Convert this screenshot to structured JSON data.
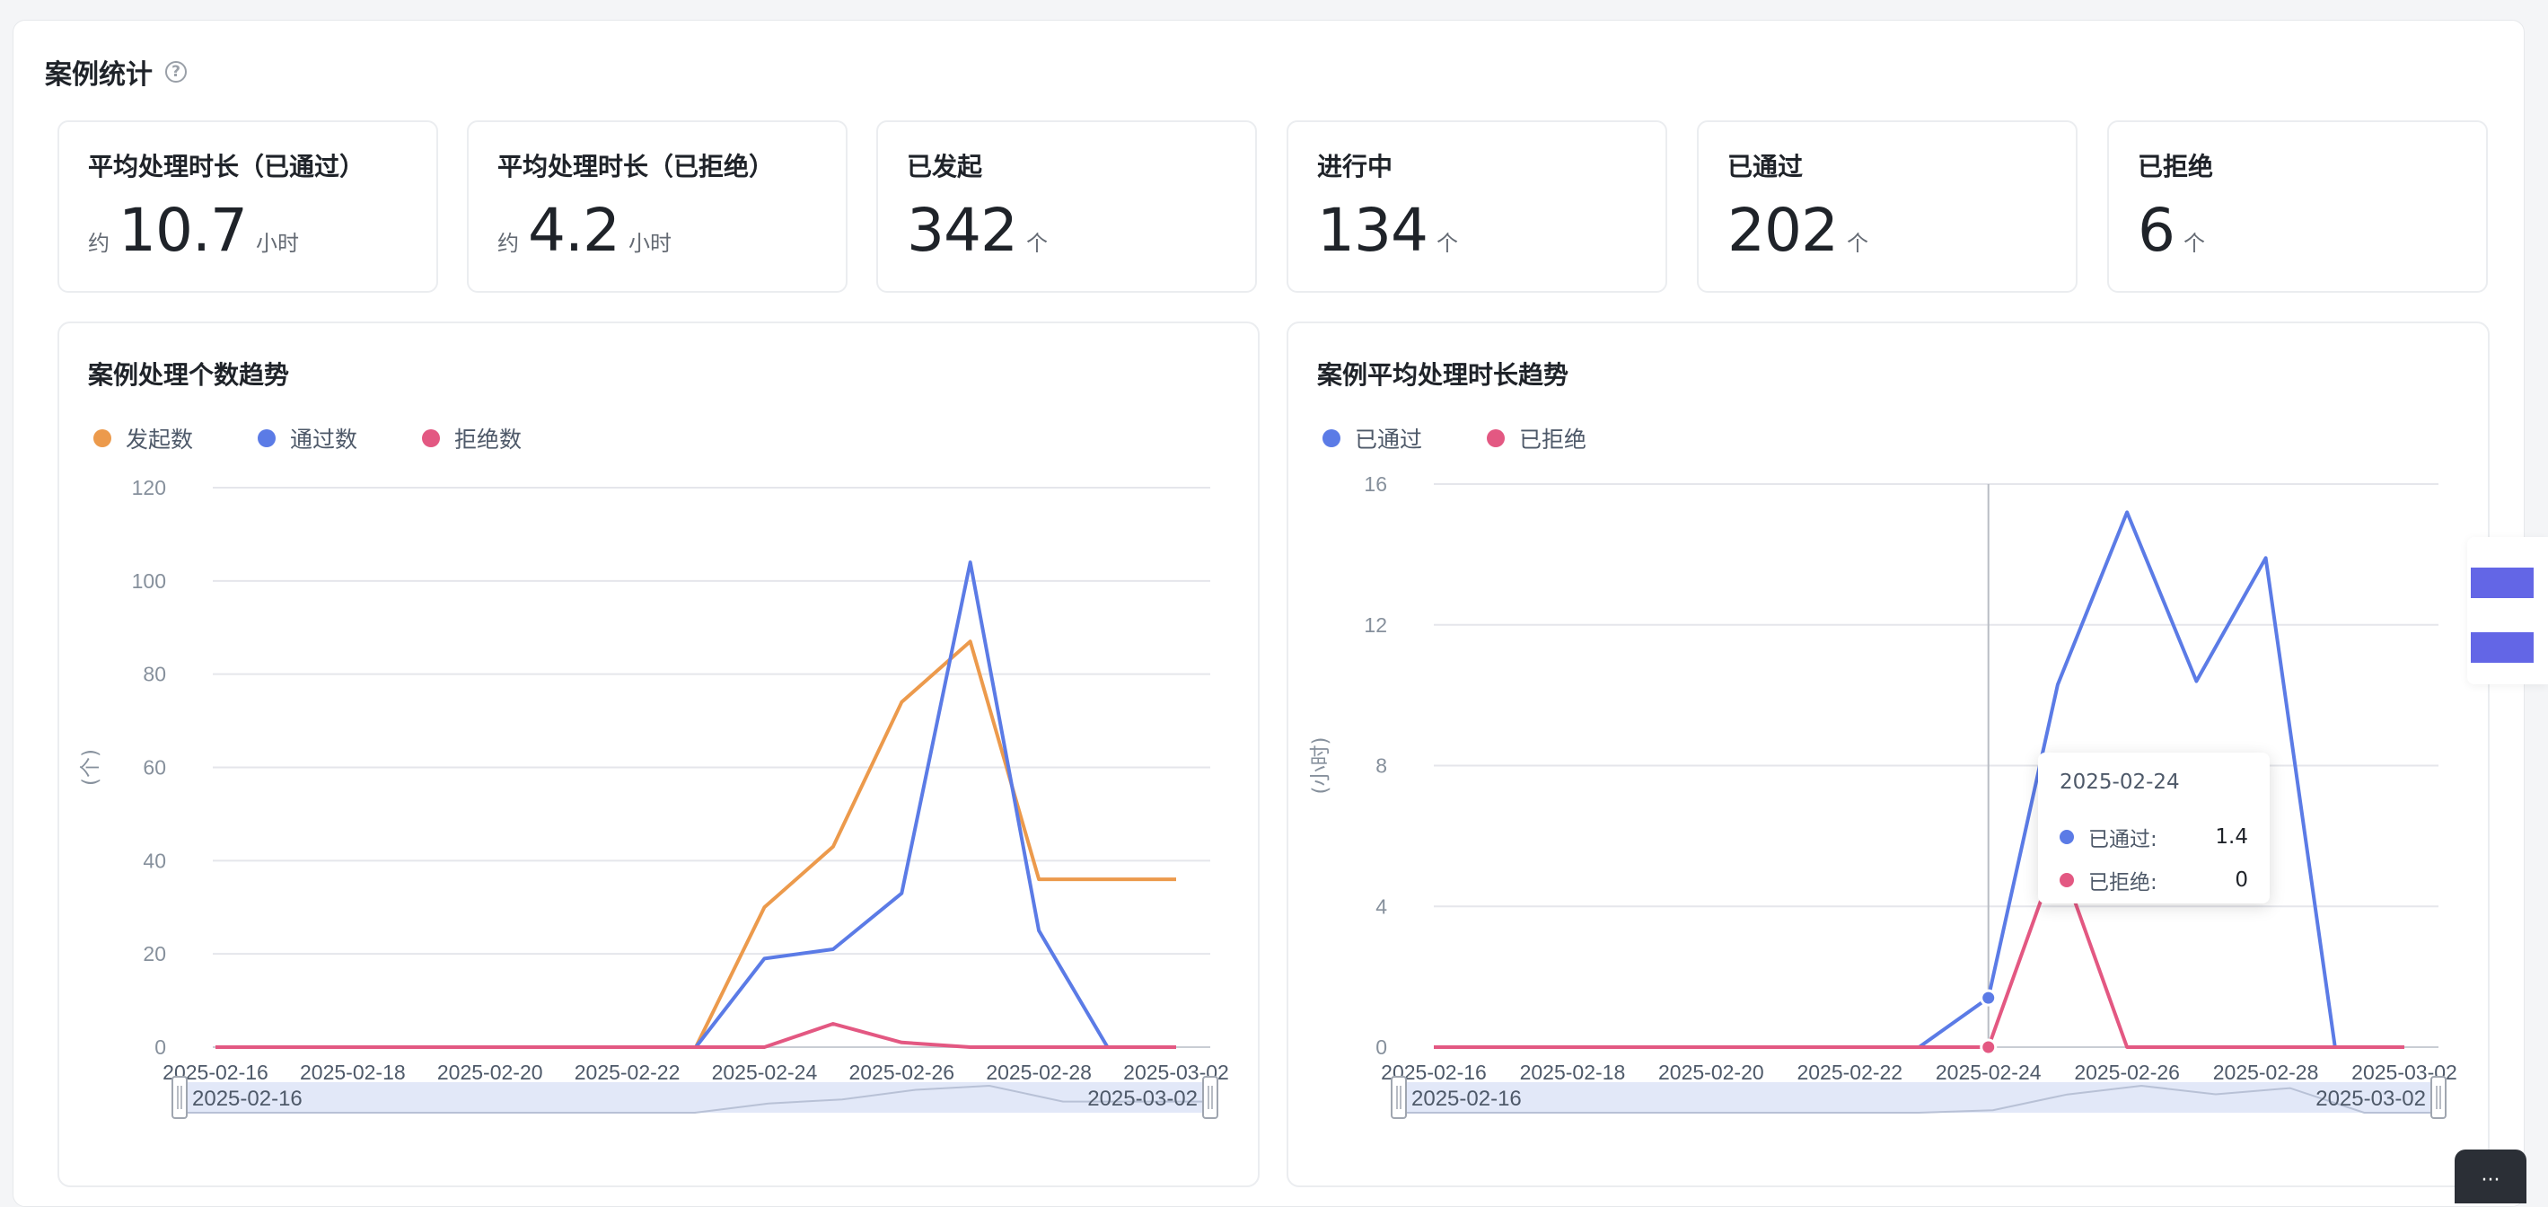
{
  "section": {
    "title": "案例统计"
  },
  "stats": [
    {
      "label": "平均处理时长（已通过）",
      "prefix": "约",
      "value": "10.7",
      "unit": "小时"
    },
    {
      "label": "平均处理时长（已拒绝）",
      "prefix": "约",
      "value": "4.2",
      "unit": "小时"
    },
    {
      "label": "已发起",
      "prefix": "",
      "value": "342",
      "unit": "个"
    },
    {
      "label": "进行中",
      "prefix": "",
      "value": "134",
      "unit": "个"
    },
    {
      "label": "已通过",
      "prefix": "",
      "value": "202",
      "unit": "个"
    },
    {
      "label": "已拒绝",
      "prefix": "",
      "value": "6",
      "unit": "个"
    }
  ],
  "charts": {
    "count": {
      "title": "案例处理个数趋势",
      "legend": [
        "发起数",
        "通过数",
        "拒绝数"
      ]
    },
    "duration": {
      "title": "案例平均处理时长趋势",
      "legend": [
        "已通过",
        "已拒绝"
      ]
    }
  },
  "tooltip": {
    "date": "2025-02-24",
    "rows": [
      {
        "name": "已通过:",
        "value": "1.4"
      },
      {
        "name": "已拒绝:",
        "value": "0"
      }
    ]
  },
  "colors": {
    "orange": "#ec9a4c",
    "blue": "#5b7be6",
    "pink": "#e35882",
    "grid": "#e5e6eb",
    "axis_text": "#86909c"
  },
  "chart_data": [
    {
      "type": "line",
      "title": "案例处理个数趋势",
      "xlabel": "",
      "ylabel": "(个)",
      "ylim": [
        0,
        120
      ],
      "yticks": [
        0,
        20,
        40,
        60,
        80,
        100,
        120
      ],
      "x": [
        "2025-02-16",
        "2025-02-17",
        "2025-02-18",
        "2025-02-19",
        "2025-02-20",
        "2025-02-21",
        "2025-02-22",
        "2025-02-23",
        "2025-02-24",
        "2025-02-25",
        "2025-02-26",
        "2025-02-27",
        "2025-02-28",
        "2025-03-01",
        "2025-03-02"
      ],
      "xtick_labels": [
        "2025-02-16",
        "2025-02-18",
        "2025-02-20",
        "2025-02-22",
        "2025-02-24",
        "2025-02-26",
        "2025-02-28",
        "2025-03-02"
      ],
      "series": [
        {
          "name": "发起数",
          "color": "#ec9a4c",
          "values": [
            0,
            0,
            0,
            0,
            0,
            0,
            0,
            0,
            30,
            43,
            74,
            87,
            36,
            36,
            36
          ]
        },
        {
          "name": "通过数",
          "color": "#5b7be6",
          "values": [
            0,
            0,
            0,
            0,
            0,
            0,
            0,
            0,
            19,
            21,
            33,
            104,
            25,
            0,
            0
          ]
        },
        {
          "name": "拒绝数",
          "color": "#e35882",
          "values": [
            0,
            0,
            0,
            0,
            0,
            0,
            0,
            0,
            0,
            5,
            1,
            0,
            0,
            0,
            0
          ]
        }
      ],
      "grid": true,
      "legend": "top-left",
      "zoom_range": [
        "2025-02-16",
        "2025-03-02"
      ]
    },
    {
      "type": "line",
      "title": "案例平均处理时长趋势",
      "xlabel": "",
      "ylabel": "(小时)",
      "ylim": [
        0,
        16
      ],
      "yticks": [
        0,
        4,
        8,
        12,
        16
      ],
      "x": [
        "2025-02-16",
        "2025-02-17",
        "2025-02-18",
        "2025-02-19",
        "2025-02-20",
        "2025-02-21",
        "2025-02-22",
        "2025-02-23",
        "2025-02-24",
        "2025-02-25",
        "2025-02-26",
        "2025-02-27",
        "2025-02-28",
        "2025-03-01",
        "2025-03-02"
      ],
      "xtick_labels": [
        "2025-02-16",
        "2025-02-18",
        "2025-02-20",
        "2025-02-22",
        "2025-02-24",
        "2025-02-26",
        "2025-02-28",
        "2025-03-02"
      ],
      "series": [
        {
          "name": "已通过",
          "color": "#5b7be6",
          "values": [
            0,
            0,
            0,
            0,
            0,
            0,
            0,
            0,
            1.4,
            10.3,
            15.2,
            10.4,
            13.9,
            0,
            0
          ]
        },
        {
          "name": "已拒绝",
          "color": "#e35882",
          "values": [
            0,
            0,
            0,
            0,
            0,
            0,
            0,
            0,
            0,
            5.5,
            0,
            0,
            0,
            0,
            0
          ]
        }
      ],
      "grid": true,
      "legend": "top-left",
      "highlight": "2025-02-24",
      "zoom_range": [
        "2025-02-16",
        "2025-03-02"
      ]
    }
  ]
}
